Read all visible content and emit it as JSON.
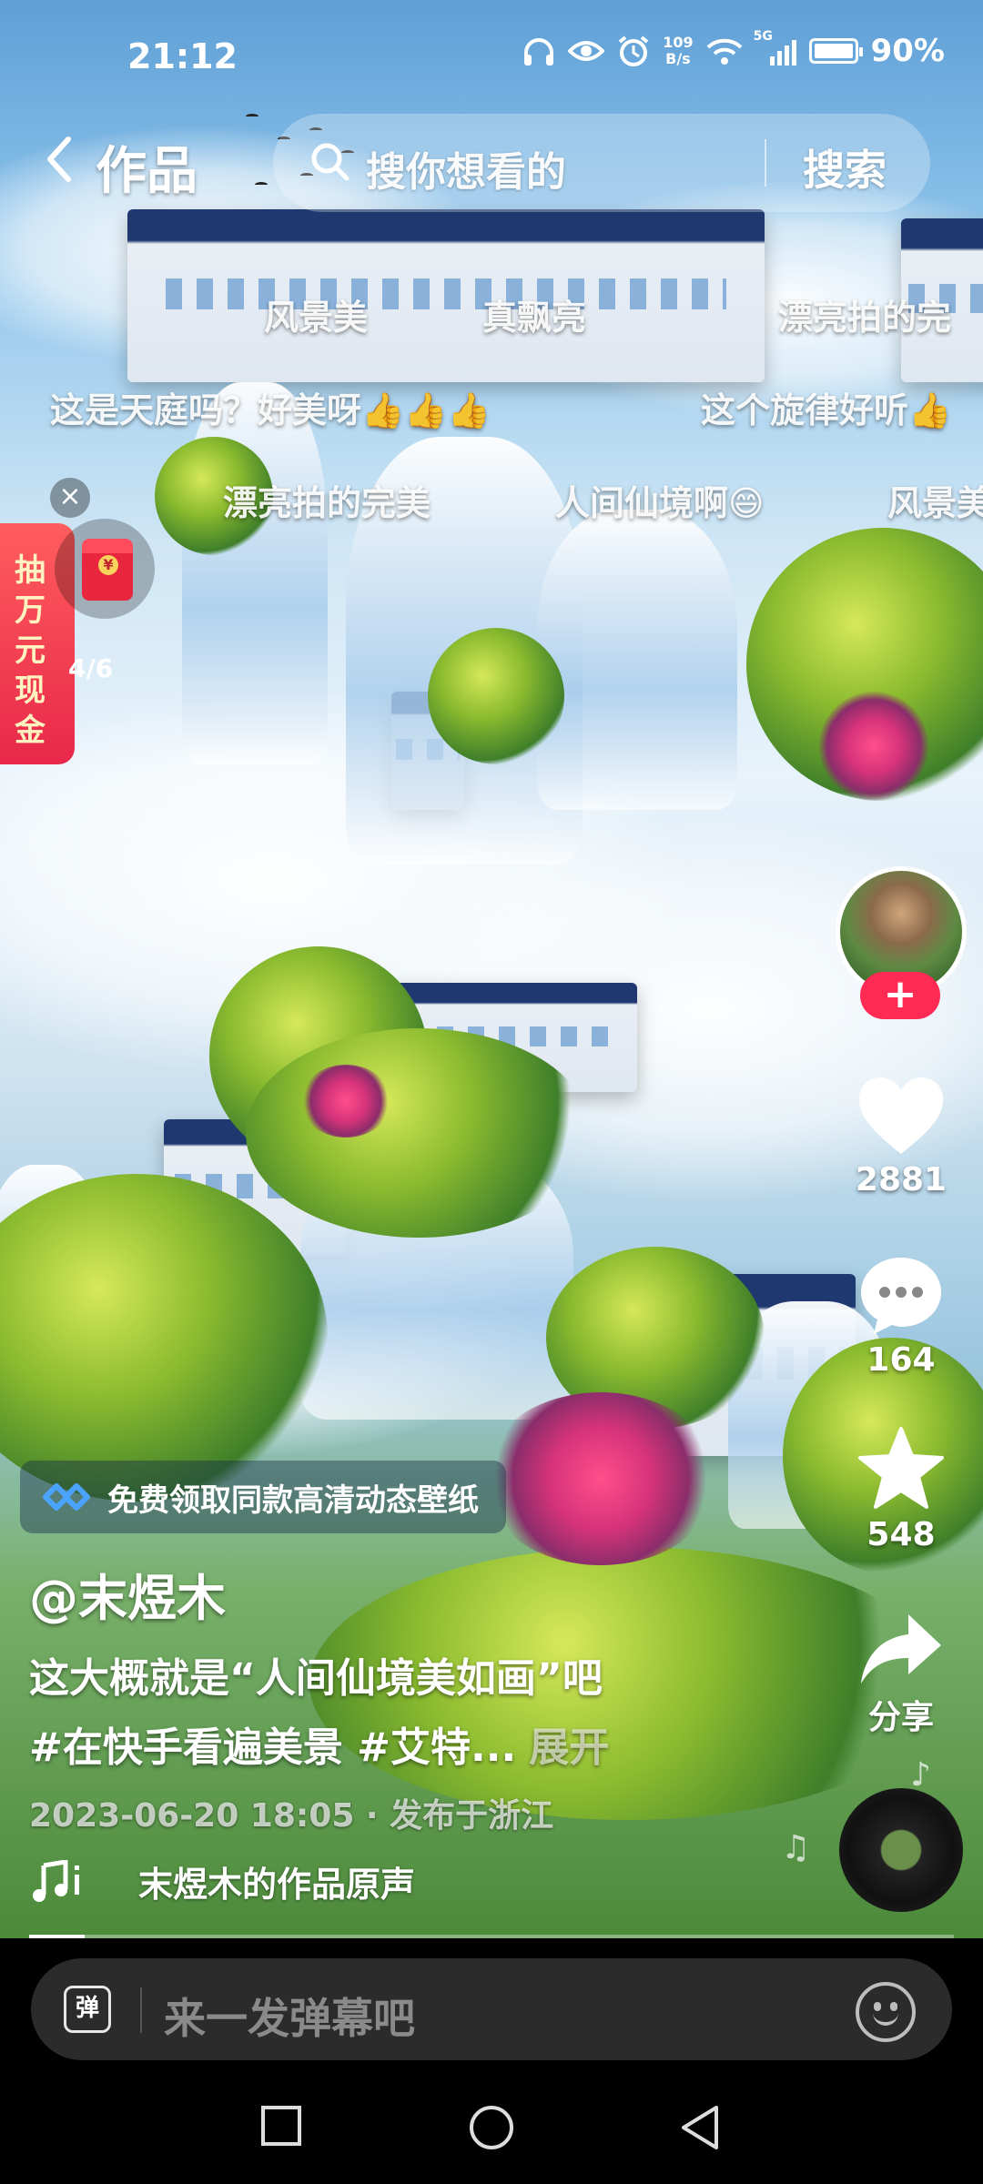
{
  "status_bar": {
    "time": "21:12",
    "net_speed_value": "109",
    "net_speed_unit": "B/s",
    "signal_label": "5G",
    "battery": "90%"
  },
  "top_bar": {
    "title": "作品",
    "search_placeholder": "搜你想看的",
    "search_button": "搜索"
  },
  "danmaku": [
    "风景美",
    "真飘亮",
    "漂亮拍的完",
    "这是天庭吗？好美呀👍👍👍",
    "这个旋律好听👍",
    "漂亮拍的完美",
    "人间仙境啊😄",
    "风景美"
  ],
  "red_packet": {
    "label": "抽万元现金",
    "progress": "4/6",
    "coin": "¥"
  },
  "actions": {
    "follow": "+",
    "likes": "2881",
    "comments": "164",
    "favorites": "548",
    "share": "分享"
  },
  "post": {
    "promo": "免费领取同款高清动态壁纸",
    "author": "@末煜木",
    "caption_line1": "这大概就是“人间仙境美如画”吧",
    "caption_line2": "#在快手看遍美景 #艾特...",
    "expand": "展开",
    "meta": "2023-06-20 18:05 · 发布于浙江",
    "music_title": "末煜木的作品原声"
  },
  "playback_progress": 0.06,
  "comment_bar": {
    "danmaku_toggle": "弹",
    "placeholder": "来一发弹幕吧"
  },
  "colors": {
    "follow_red": "#ff2b55",
    "red_packet": "#e8284a"
  }
}
